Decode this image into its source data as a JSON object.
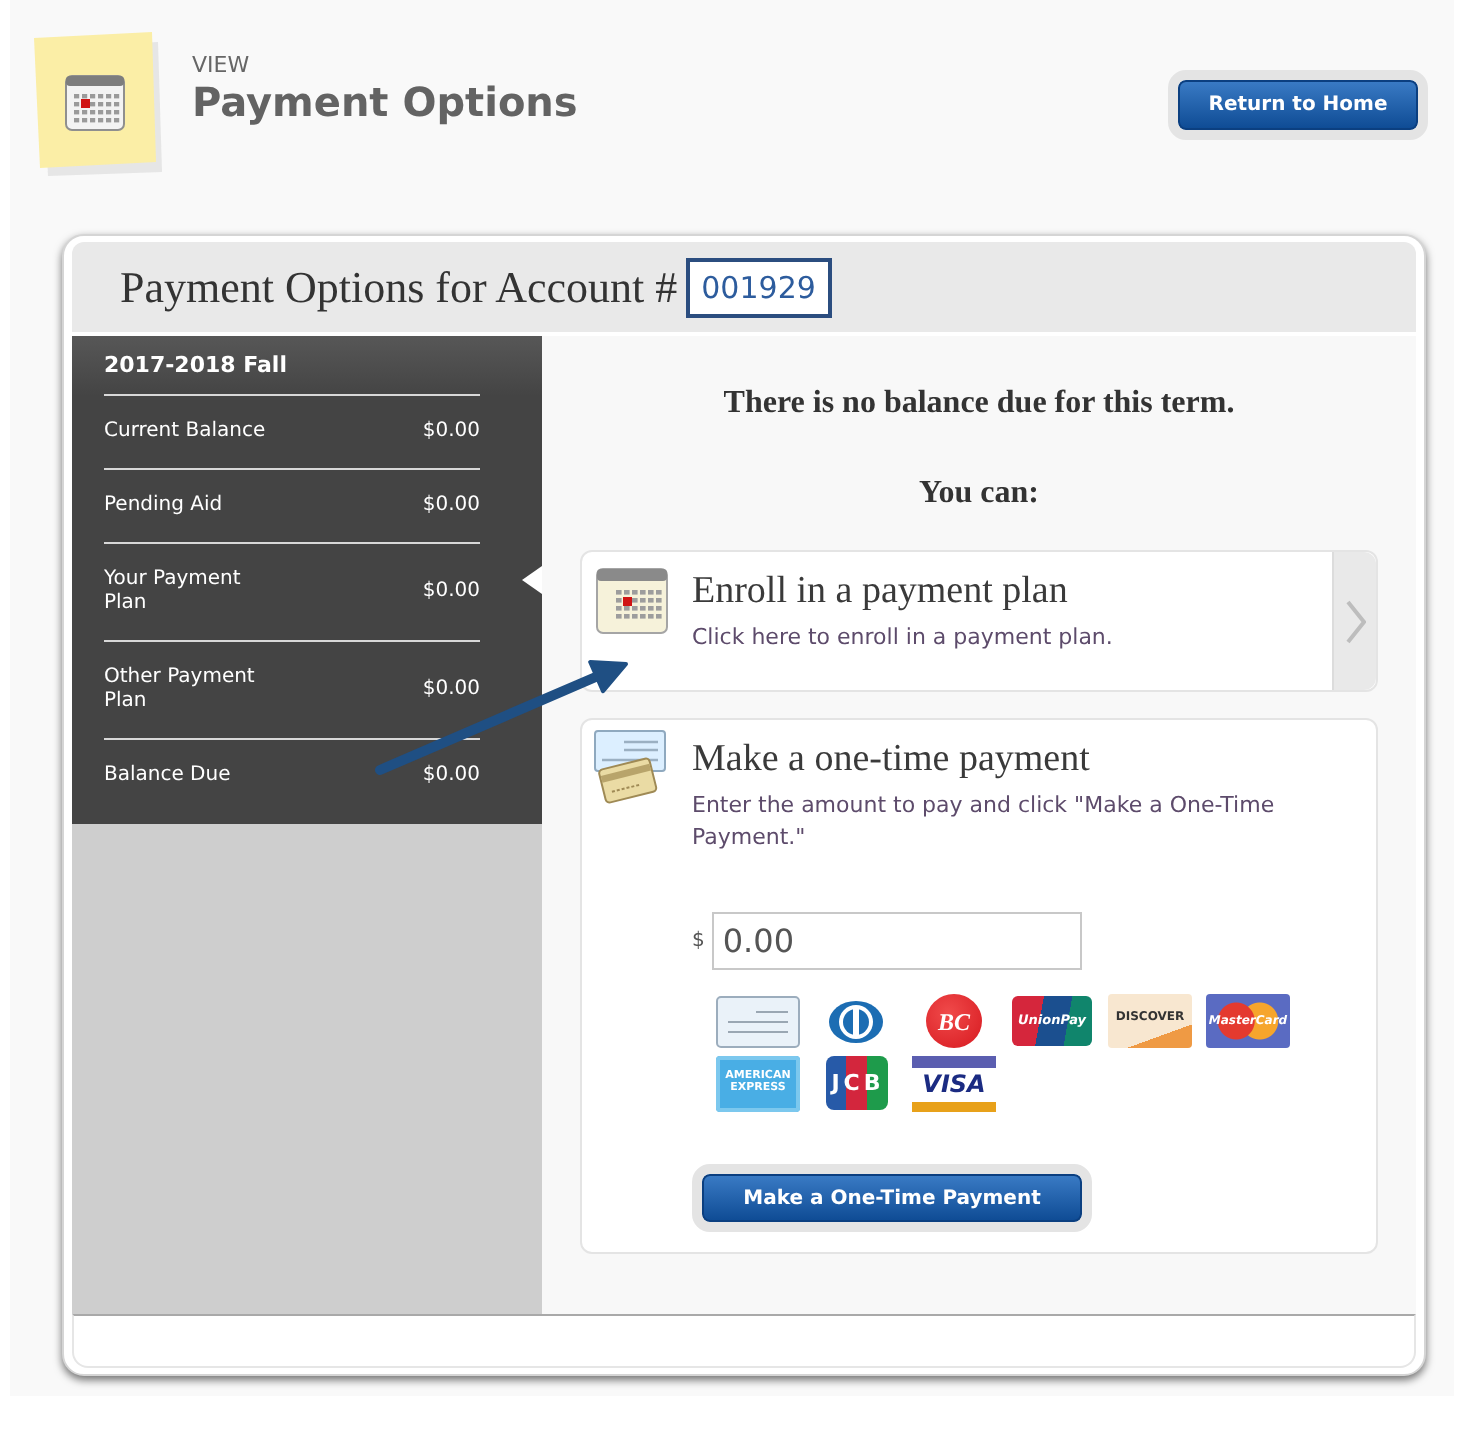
{
  "header": {
    "eyebrow": "VIEW",
    "title": "Payment Options",
    "home_button": "Return to Home"
  },
  "account": {
    "heading": "Payment Options for Account #",
    "number": "001929"
  },
  "summary": {
    "term": "2017-2018 Fall",
    "rows": [
      {
        "label": "Current Balance",
        "amount": "$0.00",
        "selected": false
      },
      {
        "label": "Pending Aid",
        "amount": "$0.00",
        "selected": false
      },
      {
        "label": "Your Payment Plan",
        "amount": "$0.00",
        "selected": true
      },
      {
        "label": "Other Payment Plan",
        "amount": "$0.00",
        "selected": false
      },
      {
        "label": "Balance Due",
        "amount": "$0.00",
        "selected": false
      }
    ]
  },
  "main": {
    "notice": "There is no balance due for this term.",
    "prompt": "You can:",
    "options": [
      {
        "kind": "plan",
        "title": "Enroll in a payment plan",
        "description": "Click here to enroll in a payment plan."
      },
      {
        "kind": "one_time",
        "title": "Make a one-time payment",
        "description": "Enter the amount to pay and click \"Make a One-Time Payment.\"",
        "amount": {
          "currency": "$",
          "value": "0.00"
        },
        "payment_methods": [
          {
            "kind": "check"
          },
          {
            "kind": "diners"
          },
          {
            "kind": "bc",
            "label": "BC"
          },
          {
            "kind": "unionpay",
            "label": "UnionPay"
          },
          {
            "kind": "discover",
            "label": "DISCOVER"
          },
          {
            "kind": "mastercard",
            "label": "MasterCard"
          },
          {
            "kind": "amex",
            "label": "AMERICAN EXPRESS"
          },
          {
            "kind": "jcb",
            "label": "JCB"
          },
          {
            "kind": "visa",
            "label": "VISA"
          }
        ],
        "submit_button": "Make a One-Time Payment"
      }
    ]
  }
}
